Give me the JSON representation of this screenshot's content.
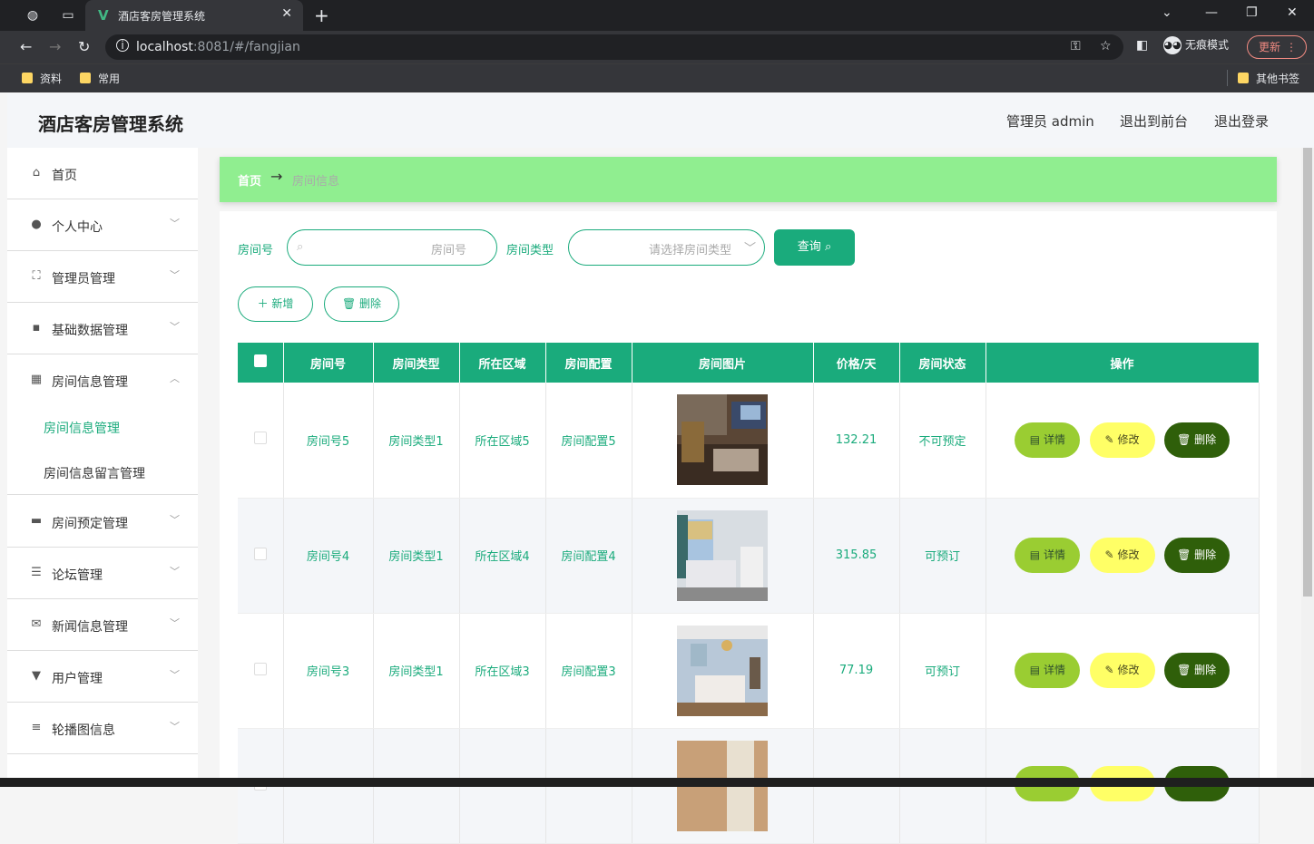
{
  "browser": {
    "tab_title": "酒店客房管理系统",
    "url_host": "localhost",
    "url_rest": ":8081/#/fangjian",
    "incognito_label": "无痕模式",
    "update_label": "更新",
    "bookmarks": [
      "资料",
      "常用"
    ],
    "other_bookmarks": "其他书签"
  },
  "header": {
    "title": "酒店客房管理系统",
    "user": "管理员 admin",
    "to_front": "退出到前台",
    "logout": "退出登录"
  },
  "sidebar": {
    "items": [
      {
        "label": "首页",
        "icon": "home-icon"
      },
      {
        "label": "个人中心",
        "icon": "user-icon"
      },
      {
        "label": "管理员管理",
        "icon": "scan-icon"
      },
      {
        "label": "基础数据管理",
        "icon": "chat-icon"
      },
      {
        "label": "房间信息管理",
        "icon": "grid-icon"
      },
      {
        "label": "房间预定管理",
        "icon": "briefcase-icon"
      },
      {
        "label": "论坛管理",
        "icon": "sliders-icon"
      },
      {
        "label": "新闻信息管理",
        "icon": "mail-icon"
      },
      {
        "label": "用户管理",
        "icon": "brush-icon"
      },
      {
        "label": "轮播图信息",
        "icon": "menu-icon"
      }
    ],
    "subitems": [
      "房间信息管理",
      "房间信息留言管理"
    ]
  },
  "breadcrumb": {
    "home": "首页",
    "current": "房间信息"
  },
  "filters": {
    "room_no_label": "房间号",
    "room_no_placeholder": "房间号",
    "room_type_label": "房间类型",
    "room_type_placeholder": "请选择房间类型",
    "query_button": "查询"
  },
  "actions": {
    "add": "新增",
    "delete": "删除"
  },
  "table": {
    "headers": [
      "房间号",
      "房间类型",
      "所在区域",
      "房间配置",
      "房间图片",
      "价格/天",
      "房间状态",
      "操作"
    ],
    "rows": [
      {
        "no": "房间号5",
        "type": "房间类型1",
        "area": "所在区域5",
        "config": "房间配置5",
        "price": "132.21",
        "status": "不可预定"
      },
      {
        "no": "房间号4",
        "type": "房间类型1",
        "area": "所在区域4",
        "config": "房间配置4",
        "price": "315.85",
        "status": "可预订"
      },
      {
        "no": "房间号3",
        "type": "房间类型1",
        "area": "所在区域3",
        "config": "房间配置3",
        "price": "77.19",
        "status": "可预订"
      },
      {
        "no": "",
        "type": "",
        "area": "",
        "config": "",
        "price": "",
        "status": ""
      }
    ],
    "row_buttons": {
      "detail": "详情",
      "edit": "修改",
      "delete": "删除"
    }
  },
  "colors": {
    "primary": "#1aab7c",
    "breadcrumb_bg": "#90ee90",
    "detail": "#9acd32",
    "edit": "#ffff66",
    "del": "#2f5f0a"
  }
}
